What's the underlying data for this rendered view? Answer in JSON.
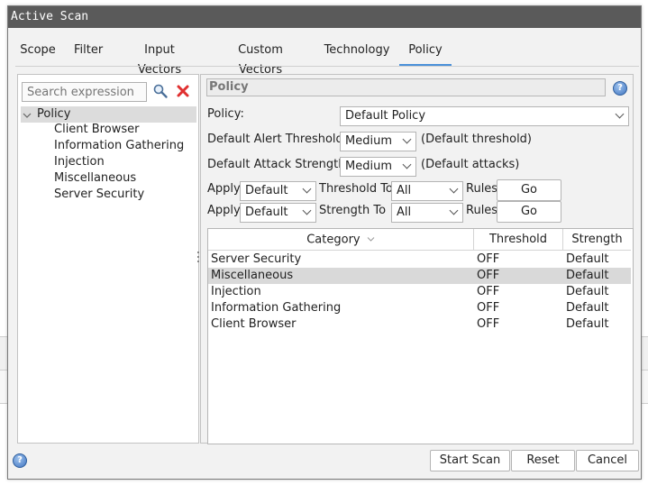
{
  "dialog": {
    "title": "Active Scan"
  },
  "tabs": [
    {
      "label": "Scope"
    },
    {
      "label": "Filter"
    },
    {
      "label": "Input Vectors"
    },
    {
      "label": "Custom Vectors"
    },
    {
      "label": "Technology"
    },
    {
      "label": "Policy"
    }
  ],
  "active_tab": "Policy",
  "search": {
    "placeholder": "Search expression"
  },
  "tree": {
    "root": "Policy",
    "children": [
      "Client Browser",
      "Information Gathering",
      "Injection",
      "Miscellaneous",
      "Server Security"
    ]
  },
  "policy_panel": {
    "header": "Policy",
    "policy_label": "Policy:",
    "policy_value": "Default Policy",
    "threshold_label": "Default Alert Threshold:",
    "threshold_value": "Medium",
    "threshold_note": "(Default threshold)",
    "strength_label": "Default Attack Strength:",
    "strength_value": "Medium",
    "strength_note": "(Default attacks)",
    "apply_rows": [
      {
        "apply": "Apply",
        "level": "Default",
        "to": "Threshold To",
        "scope": "All",
        "rules": "Rules",
        "go": "Go"
      },
      {
        "apply": "Apply",
        "level": "Default",
        "to": "Strength To",
        "scope": "All",
        "rules": "Rules",
        "go": "Go"
      }
    ]
  },
  "table": {
    "columns": [
      "Category",
      "Threshold",
      "Strength"
    ],
    "rows": [
      {
        "category": "Server Security",
        "threshold": "OFF",
        "strength": "Default"
      },
      {
        "category": "Miscellaneous",
        "threshold": "OFF",
        "strength": "Default"
      },
      {
        "category": "Injection",
        "threshold": "OFF",
        "strength": "Default"
      },
      {
        "category": "Information Gathering",
        "threshold": "OFF",
        "strength": "Default"
      },
      {
        "category": "Client Browser",
        "threshold": "OFF",
        "strength": "Default"
      }
    ],
    "selected_row": 1
  },
  "footer": {
    "start_label": "Start Scan",
    "reset_label": "Reset",
    "cancel_label": "Cancel"
  },
  "colors": {
    "titlebar": "#5a5a5a",
    "tab_underline": "#4a90d9",
    "delete_icon": "#e03030",
    "help_icon": "#3f74c0",
    "selected_row": "#d9d9d9"
  }
}
